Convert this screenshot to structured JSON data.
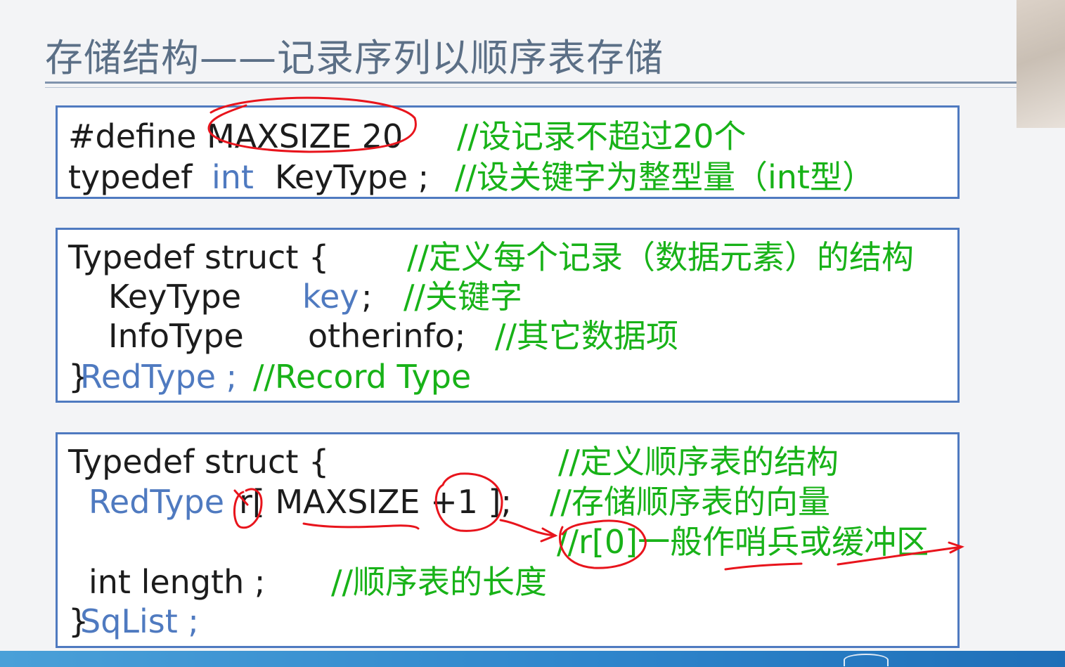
{
  "title": "存储结构——记录序列以顺序表存储",
  "box1": {
    "line1_code": "#define MAXSIZE 20",
    "line1_comment": "//设记录不超过20个",
    "line2_typedef": "typedef",
    "line2_int": "int",
    "line2_rest": "KeyType ;",
    "line2_comment": "//设关键字为整型量（int型）"
  },
  "box2": {
    "line1_code": "Typedef  struct {",
    "line1_comment": "//定义每个记录（数据元素）的结构",
    "line2_type": "KeyType",
    "line2_field": "key",
    "line2_semi": ";",
    "line2_comment": "//关键字",
    "line3_type": "InfoType",
    "line3_field": "otherinfo;",
    "line3_comment": "//其它数据项",
    "line4_brace": "}",
    "line4_name": "RedType ;",
    "line4_comment": "//Record Type"
  },
  "box3": {
    "line1_code": "Typedef  struct {",
    "line1_comment": "//定义顺序表的结构",
    "line2_type": "RedType",
    "line2_code": "r[ MAXSIZE +1 ];",
    "line2_comment": "//存储顺序表的向量",
    "line3_comment": "//r[0]一般作哨兵或缓冲区",
    "line4_code": "int length ;",
    "line4_comment": "//顺序表的长度",
    "line5_brace": "}",
    "line5_name": "SqList ;"
  },
  "colors": {
    "title": "#5b6f86",
    "box_border": "#4f7ac0",
    "keyword_blue": "#4f7ac0",
    "comment_green": "#18b218",
    "annotation_red": "#e8141c"
  }
}
